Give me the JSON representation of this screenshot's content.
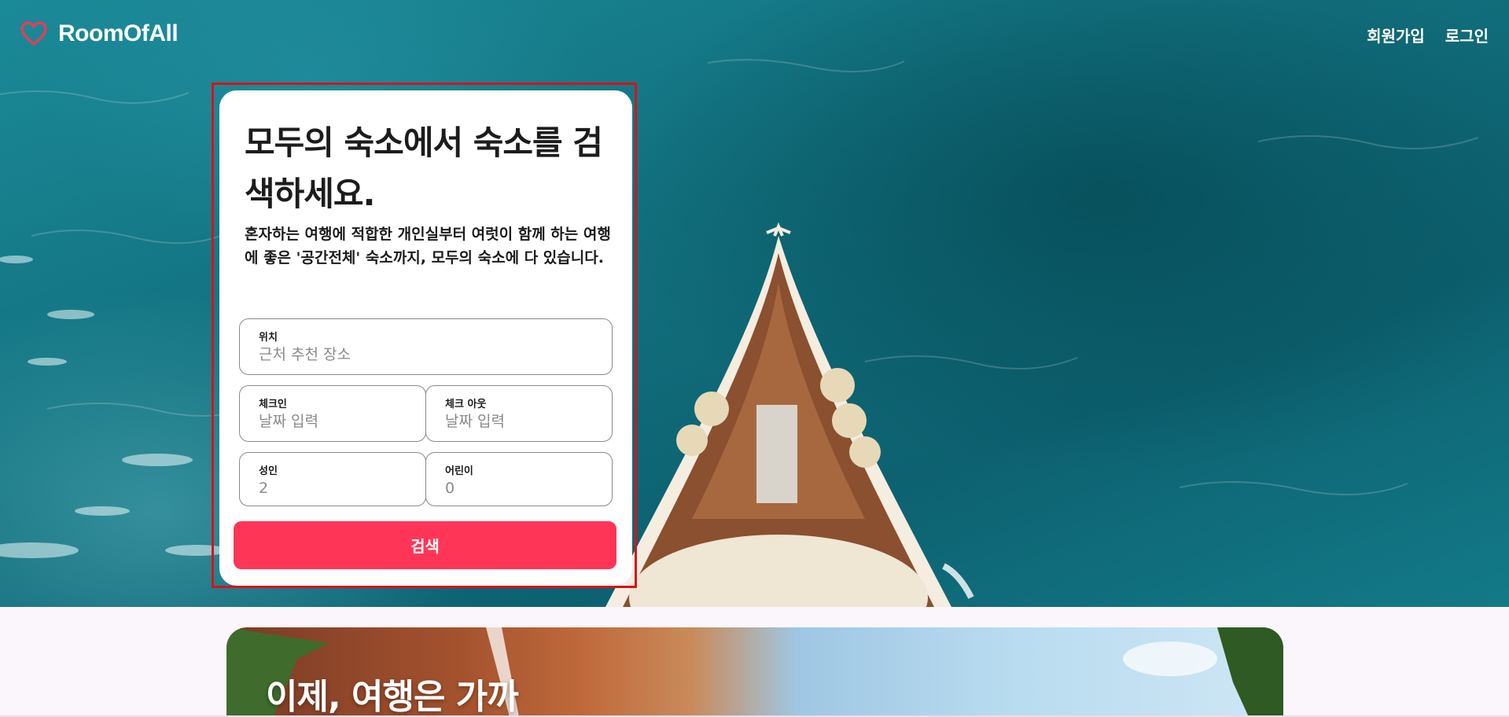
{
  "brand": {
    "name": "RoomOfAll",
    "icon": "heart-outline-icon",
    "accent": "#ff3558"
  },
  "nav": {
    "signup_label": "회원가입",
    "login_label": "로그인"
  },
  "search_card": {
    "headline": "모두의 숙소에서 숙소를 검색하세요.",
    "description": "혼자하는 여행에 적합한 개인실부터 여럿이 함께 하는 여행에 좋은 '공간전체' 숙소까지, 모두의 숙소에 다 있습니다.",
    "location": {
      "label": "위치",
      "placeholder": "근처 추천 장소"
    },
    "checkin": {
      "label": "체크인",
      "placeholder": "날짜 입력"
    },
    "checkout": {
      "label": "체크 아웃",
      "placeholder": "날짜 입력"
    },
    "adults": {
      "label": "성인",
      "placeholder": "2"
    },
    "children": {
      "label": "어린이",
      "placeholder": "0"
    },
    "search_label": "검색"
  },
  "promo": {
    "title": "이제, 여행은 가까"
  }
}
